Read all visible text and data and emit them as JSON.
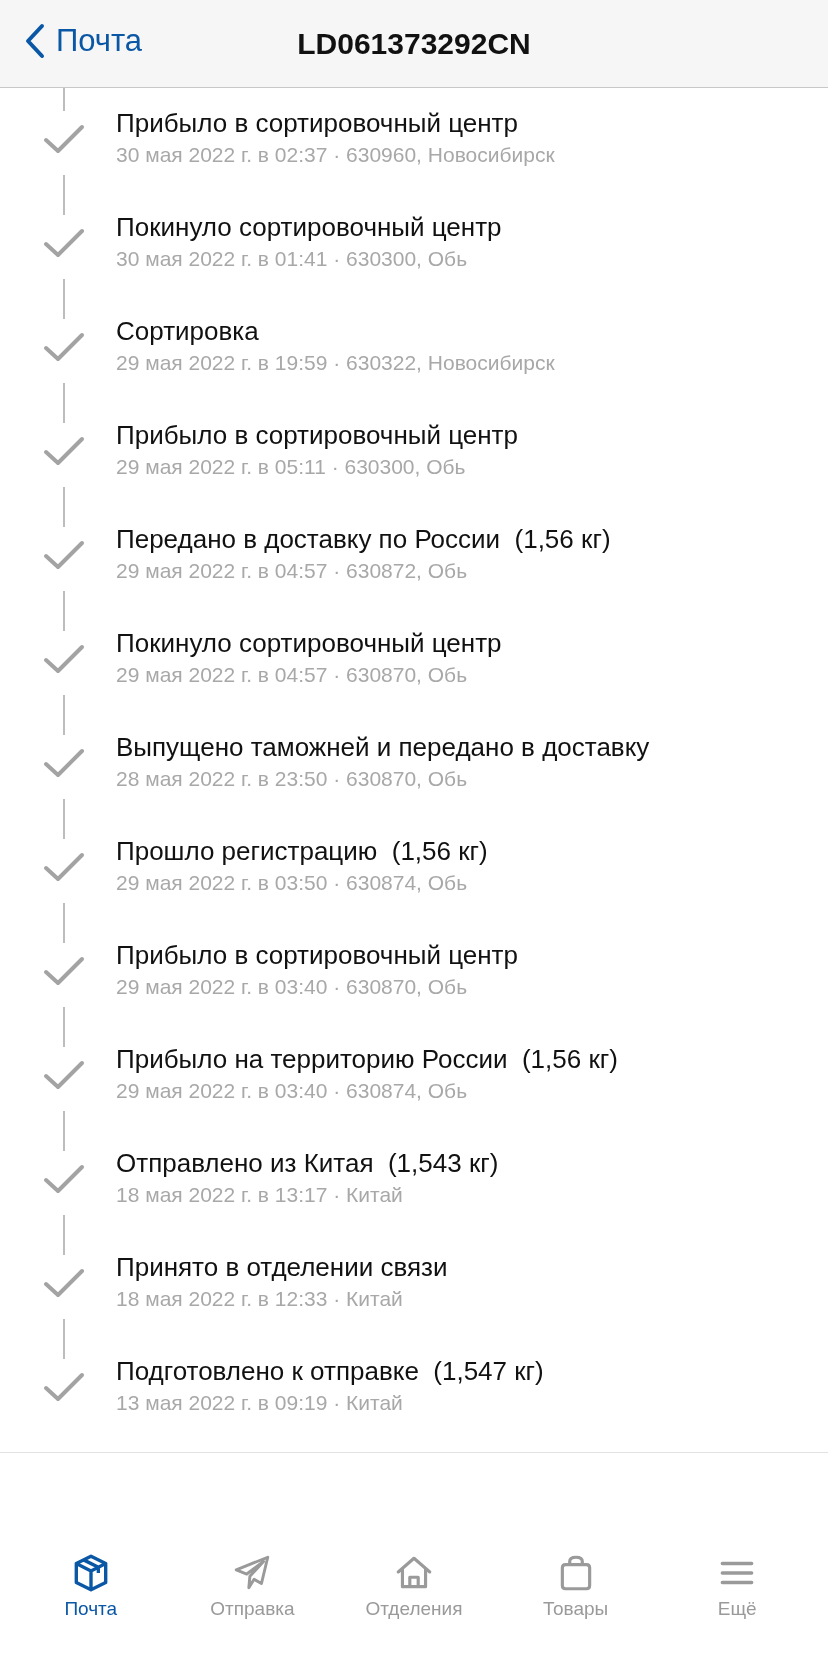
{
  "nav_bar": {
    "back_label": "Почта",
    "title": "LD061373292CN"
  },
  "events": [
    {
      "title": "Прибыло в сортировочный центр",
      "detail": "30 мая 2022 г. в 02:37 · 630960, Новосибирск"
    },
    {
      "title": "Покинуло сортировочный центр",
      "detail": "30 мая 2022 г. в 01:41 · 630300, Обь"
    },
    {
      "title": "Сортировка",
      "detail": "29 мая 2022 г. в 19:59 · 630322, Новосибирск"
    },
    {
      "title": "Прибыло в сортировочный центр",
      "detail": "29 мая 2022 г. в 05:11 · 630300, Обь"
    },
    {
      "title": "Передано в доставку по России  (1,56 кг)",
      "detail": "29 мая 2022 г. в 04:57 · 630872, Обь"
    },
    {
      "title": "Покинуло сортировочный центр",
      "detail": "29 мая 2022 г. в 04:57 · 630870, Обь"
    },
    {
      "title": "Выпущено таможней и передано в доставку",
      "detail": "28 мая 2022 г. в 23:50 · 630870, Обь"
    },
    {
      "title": "Прошло регистрацию  (1,56 кг)",
      "detail": "29 мая 2022 г. в 03:50 · 630874, Обь"
    },
    {
      "title": "Прибыло в сортировочный центр",
      "detail": "29 мая 2022 г. в 03:40 · 630870, Обь"
    },
    {
      "title": "Прибыло на территорию России  (1,56 кг)",
      "detail": "29 мая 2022 г. в 03:40 · 630874, Обь"
    },
    {
      "title": "Отправлено из Китая  (1,543 кг)",
      "detail": "18 мая 2022 г. в 13:17 · Китай"
    },
    {
      "title": "Принято в отделении связи",
      "detail": "18 мая 2022 г. в 12:33 · Китай"
    },
    {
      "title": "Подготовлено к отправке  (1,547 кг)",
      "detail": "13 мая 2022 г. в 09:19 · Китай"
    }
  ],
  "tab_bar": [
    {
      "kind": "box",
      "label": "Почта",
      "selected": true
    },
    {
      "kind": "plane",
      "label": "Отправка",
      "selected": false
    },
    {
      "kind": "house",
      "label": "Отделения",
      "selected": false
    },
    {
      "kind": "bag",
      "label": "Товары",
      "selected": false
    },
    {
      "kind": "menu",
      "label": "Ещё",
      "selected": false
    }
  ]
}
